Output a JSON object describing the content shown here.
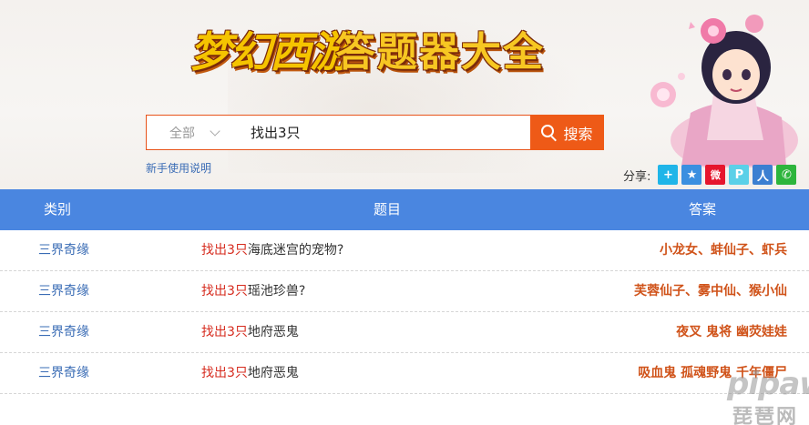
{
  "header": {
    "logo_game": "梦幻西游",
    "logo_rest": "答题器大全"
  },
  "search": {
    "category_selected": "全部",
    "query_value": "找出3只",
    "button_label": "搜索"
  },
  "help_link": "新手使用说明",
  "share": {
    "label": "分享:",
    "buttons": [
      {
        "name": "share-plus",
        "glyph": "+",
        "color": "#1fb5e8"
      },
      {
        "name": "share-qzone",
        "glyph": "★",
        "color": "#3a8fe0"
      },
      {
        "name": "share-weibo",
        "glyph": "微",
        "color": "#e6162d"
      },
      {
        "name": "share-pengyou",
        "glyph": "P",
        "color": "#5bd0e8"
      },
      {
        "name": "share-renren",
        "glyph": "人",
        "color": "#3b7fd1"
      },
      {
        "name": "share-wechat",
        "glyph": "✆",
        "color": "#2db53c"
      }
    ]
  },
  "table": {
    "headers": {
      "category": "类别",
      "question": "题目",
      "answer": "答案"
    },
    "rows": [
      {
        "category": "三界奇缘",
        "q_highlight": "找出3只",
        "q_rest": "海底迷宫的宠物?",
        "answer": "小龙女、蚌仙子、虾兵"
      },
      {
        "category": "三界奇缘",
        "q_highlight": "找出3只",
        "q_rest": "瑶池珍兽?",
        "answer": "芙蓉仙子、雾中仙、猴小仙"
      },
      {
        "category": "三界奇缘",
        "q_highlight": "找出3只",
        "q_rest": "地府恶鬼",
        "answer": "夜叉 鬼将 幽荧娃娃"
      },
      {
        "category": "三界奇缘",
        "q_highlight": "找出3只",
        "q_rest": "地府恶鬼",
        "answer": "吸血鬼 孤魂野鬼 千年僵尸"
      }
    ]
  },
  "watermark": {
    "brand": "pipaw",
    "cn": "琵琶网"
  }
}
